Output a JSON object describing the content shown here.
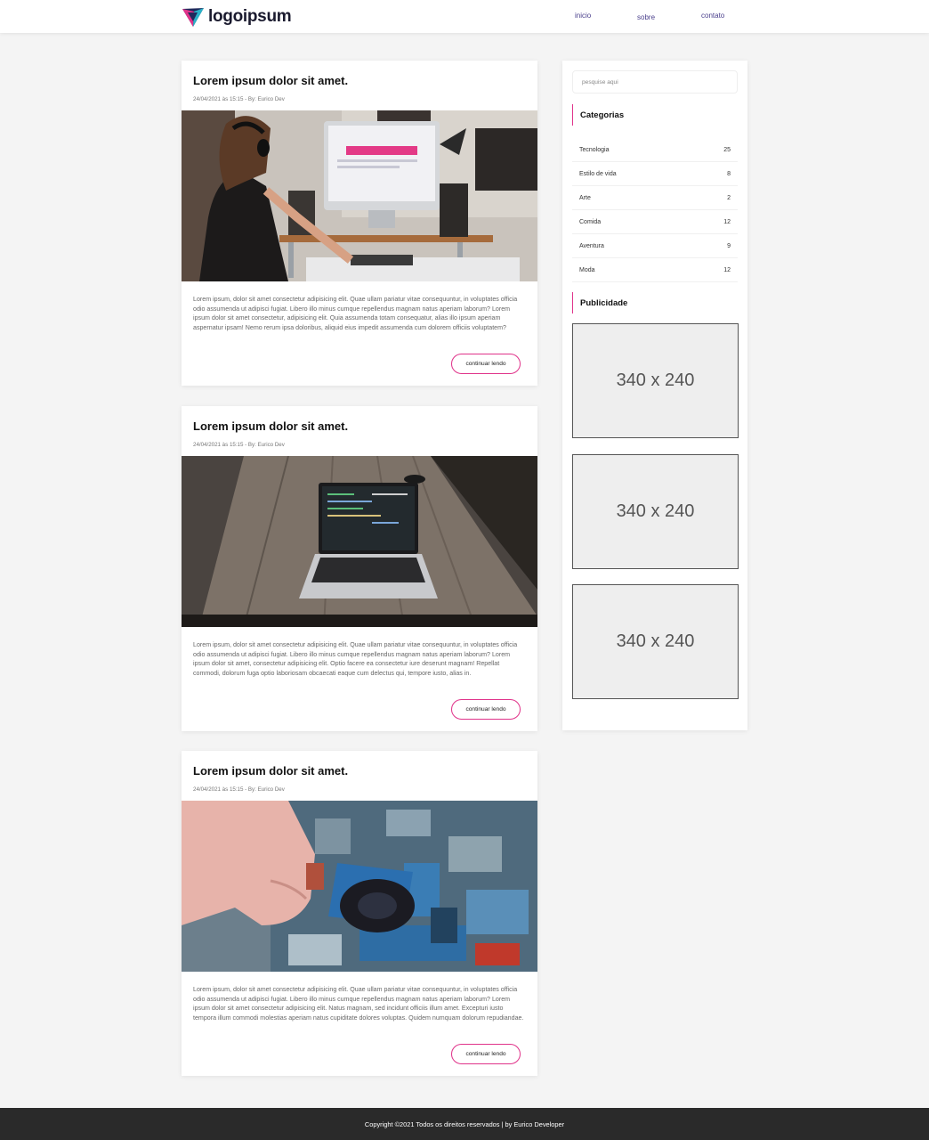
{
  "header": {
    "logo_text": "logoipsum",
    "nav": [
      {
        "label": "inicio"
      },
      {
        "label": "sobre"
      },
      {
        "label": "contato"
      }
    ]
  },
  "posts": [
    {
      "title": "Lorem ipsum dolor sit amet.",
      "meta": "24/04/2021 às 15:15 - By: Eurico Dev",
      "image": "woman-at-computer-photo",
      "body": "Lorem ipsum, dolor sit amet consectetur adipisicing elit. Quae ullam pariatur vitae consequuntur, in voluptates officia odio assumenda ut adipisci fugiat. Libero illo minus cumque repellendus magnam natus aperiam laborum? Lorem ipsum dolor sit amet consectetur, adipisicing elit. Quia assumenda totam consequatur, alias illo ipsum aperiam aspernatur ipsam! Nemo rerum ipsa doloribus, aliquid eius impedit assumenda cum dolorem officiis voluptatem?",
      "button": "continuar lendo"
    },
    {
      "title": "Lorem ipsum dolor sit amet.",
      "meta": "24/04/2021 às 15:15 - By: Eurico Dev",
      "image": "laptop-on-table-photo",
      "body": "Lorem ipsum, dolor sit amet consectetur adipisicing elit. Quae ullam pariatur vitae consequuntur, in voluptates officia odio assumenda ut adipisci fugiat. Libero illo minus cumque repellendus magnam natus aperiam laborum? Lorem ipsum dolor sit amet, consectetur adipisicing elit. Optio facere ea consectetur iure deserunt magnam! Repellat commodi, dolorum fuga optio laboriosam obcaecati eaque cum delectus qui, tempore iusto, alias in.",
      "button": "continuar lendo"
    },
    {
      "title": "Lorem ipsum dolor sit amet.",
      "meta": "24/04/2021 às 15:15 - By: Eurico Dev",
      "image": "letterpress-roller-photo",
      "body": "Lorem ipsum, dolor sit amet consectetur adipisicing elit. Quae ullam pariatur vitae consequuntur, in voluptates officia odio assumenda ut adipisci fugiat. Libero illo minus cumque repellendus magnam natus aperiam laborum? Lorem ipsum dolor sit amet consectetur adipisicing elit. Natus magnam, sed incidunt officiis illum amet. Excepturi iusto tempora illum commodi molestias aperiam natus cupiditate dolores voluptas. Quidem numquam dolorum repudiandae.",
      "button": "continuar lendo"
    }
  ],
  "sidebar": {
    "search_placeholder": "pesquise aqui",
    "categories_title": "Categorias",
    "categories": [
      {
        "name": "Tecnologia",
        "count": "25"
      },
      {
        "name": "Estilo de vida",
        "count": "8"
      },
      {
        "name": "Arte",
        "count": "2"
      },
      {
        "name": "Comida",
        "count": "12"
      },
      {
        "name": "Aventura",
        "count": "9"
      },
      {
        "name": "Moda",
        "count": "12"
      }
    ],
    "ads_title": "Publicidade",
    "ads": [
      {
        "label": "340 x 240"
      },
      {
        "label": "340 x 240"
      },
      {
        "label": "340 x 240"
      }
    ]
  },
  "footer": {
    "text": "Copyright ©2021 Todos os direitos reservados | by Eurico Developer"
  },
  "colors": {
    "accent": "#e0338a",
    "nav_link": "#4a3f8c",
    "background": "#f4f4f4",
    "footer_bg": "#2a2a2a"
  }
}
